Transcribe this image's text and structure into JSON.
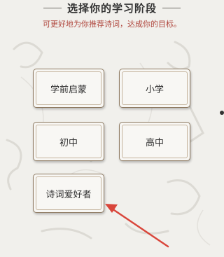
{
  "header": {
    "title": "选择你的学习阶段",
    "subtitle": "可更好地为你推荐诗词，达成你的目标。"
  },
  "stages": [
    {
      "label": "学前启蒙"
    },
    {
      "label": "小学"
    },
    {
      "label": "初中"
    },
    {
      "label": "高中"
    },
    {
      "label": "诗词爱好者"
    }
  ],
  "colors": {
    "subtitle": "#b0473e",
    "arrow": "#d9463b",
    "card_border": "#8f7b63"
  },
  "icons": {
    "annotation": "annotation-arrow-icon"
  }
}
